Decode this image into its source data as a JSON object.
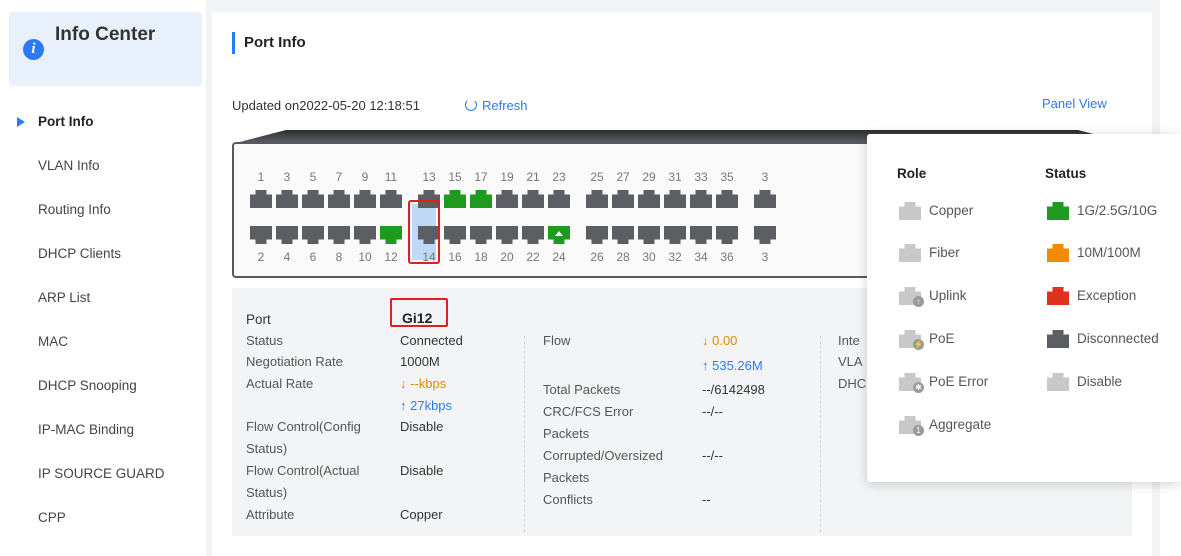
{
  "sidebar": {
    "title": "Info Center",
    "items": [
      {
        "label": "Port Info",
        "active": true
      },
      {
        "label": "VLAN Info"
      },
      {
        "label": "Routing Info"
      },
      {
        "label": "DHCP Clients"
      },
      {
        "label": "ARP List"
      },
      {
        "label": "MAC"
      },
      {
        "label": "DHCP Snooping"
      },
      {
        "label": "IP-MAC Binding"
      },
      {
        "label": "IP SOURCE GUARD"
      },
      {
        "label": "CPP"
      }
    ]
  },
  "header": {
    "title": "Port Info",
    "updated": "Updated on2022-05-20 12:18:51",
    "refresh": "Refresh",
    "panel_view": "Panel View"
  },
  "panel": {
    "top_ports": [
      "1",
      "3",
      "5",
      "7",
      "9",
      "11",
      "13",
      "15",
      "17",
      "19",
      "21",
      "23",
      "25",
      "27",
      "29",
      "31",
      "33",
      "35",
      "3"
    ],
    "bottom_ports": [
      "2",
      "4",
      "6",
      "8",
      "10",
      "12",
      "14",
      "16",
      "18",
      "20",
      "22",
      "24",
      "26",
      "28",
      "30",
      "32",
      "34",
      "36",
      "3"
    ],
    "connected_ports": [
      "12",
      "15",
      "17",
      "24"
    ],
    "uplink_ports": [
      "24"
    ],
    "selected_port": "12"
  },
  "port_detail": {
    "port_label": "Port",
    "port_name": "Gi12",
    "col1": [
      {
        "label": "Status",
        "value": "Connected"
      },
      {
        "label": "Negotiation Rate",
        "value": "1000M"
      },
      {
        "label": "Actual Rate",
        "value_down": "↓ --kbps",
        "value_up": "↑ 27kbps"
      },
      {
        "label_l1": "Flow Control(Config",
        "label_l2": "Status)",
        "value": "Disable"
      },
      {
        "label_l1": "Flow Control(Actual",
        "label_l2": "Status)",
        "value": "Disable"
      },
      {
        "label": "Attribute",
        "value": "Copper"
      }
    ],
    "col2": [
      {
        "label": "Flow",
        "value_down": "↓ 0.00",
        "value_up": "↑ 535.26M"
      },
      {
        "label": "Total Packets",
        "value": "--/6142498"
      },
      {
        "label_l1": "CRC/FCS Error",
        "label_l2": "Packets",
        "value": "--/--"
      },
      {
        "label_l1": "Corrupted/Oversized",
        "label_l2": "Packets",
        "value": "--/--"
      },
      {
        "label": "Conflicts",
        "value": "--"
      }
    ],
    "col3_partial": [
      "Inte",
      "VLA",
      "DHC"
    ]
  },
  "legend": {
    "role_title": "Role",
    "status_title": "Status",
    "roles": [
      {
        "label": "Copper",
        "color": "#c8c8c8"
      },
      {
        "label": "Fiber",
        "color": "#c8c8c8"
      },
      {
        "label": "Uplink",
        "color": "#c8c8c8",
        "badge": "↑"
      },
      {
        "label": "PoE",
        "color": "#c8c8c8",
        "badge": "⚡"
      },
      {
        "label": "PoE Error",
        "color": "#c8c8c8",
        "badge": "✱"
      },
      {
        "label": "Aggregate",
        "color": "#c8c8c8",
        "badge": "1"
      }
    ],
    "statuses": [
      {
        "label": "1G/2.5G/10G",
        "color": "#1e9a1e"
      },
      {
        "label": "10M/100M",
        "color": "#f08a00"
      },
      {
        "label": "Exception",
        "color": "#e03020"
      },
      {
        "label": "Disconnected",
        "color": "#5b5e63"
      },
      {
        "label": "Disable",
        "color": "#c8c8c8"
      }
    ]
  }
}
